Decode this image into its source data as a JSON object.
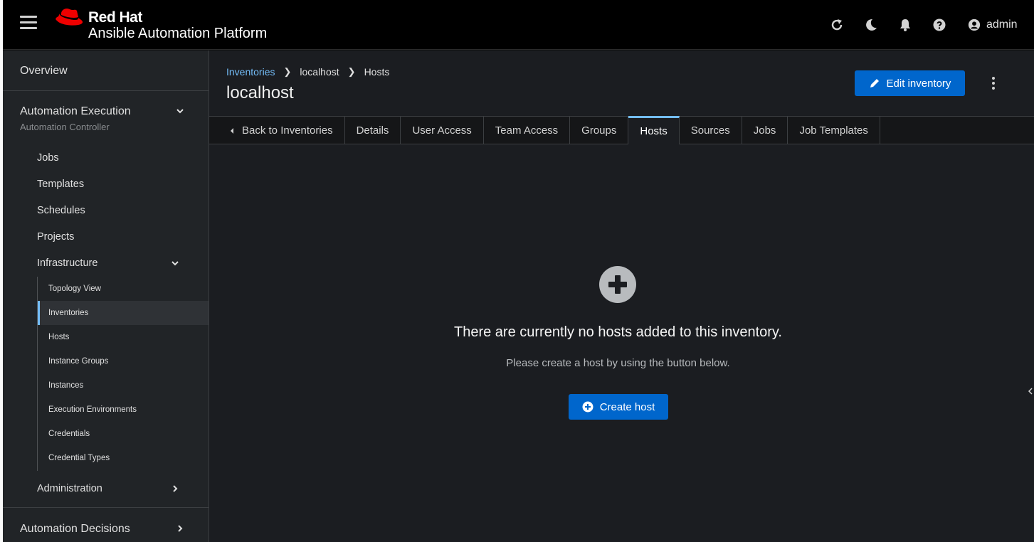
{
  "header": {
    "brand_top": "Red Hat",
    "brand_bottom": "Ansible Automation Platform",
    "user": "admin",
    "icons": [
      "menu-icon",
      "refresh-icon",
      "moon-icon",
      "bell-icon",
      "help-icon",
      "user-icon"
    ]
  },
  "sidebar": {
    "overview": "Overview",
    "execution": {
      "title": "Automation Execution",
      "subtitle": "Automation Controller",
      "items": [
        "Jobs",
        "Templates",
        "Schedules",
        "Projects"
      ],
      "infrastructure": {
        "title": "Infrastructure",
        "items": [
          "Topology View",
          "Inventories",
          "Hosts",
          "Instance Groups",
          "Instances",
          "Execution Environments",
          "Credentials",
          "Credential Types"
        ],
        "active": "Inventories"
      },
      "administration": "Administration"
    },
    "decisions": "Automation Decisions"
  },
  "main": {
    "breadcrumb": [
      "Inventories",
      "localhost",
      "Hosts"
    ],
    "title": "localhost",
    "edit_label": "Edit inventory",
    "tabs": [
      "Back to Inventories",
      "Details",
      "User Access",
      "Team Access",
      "Groups",
      "Hosts",
      "Sources",
      "Jobs",
      "Job Templates"
    ],
    "active_tab": "Hosts",
    "empty": {
      "title": "There are currently no hosts added to this inventory.",
      "body": "Please create a host by using the button below.",
      "button": "Create host"
    }
  },
  "colors": {
    "accent": "#0066cc",
    "link": "#73bcf7",
    "brand_red": "#ee0000"
  }
}
